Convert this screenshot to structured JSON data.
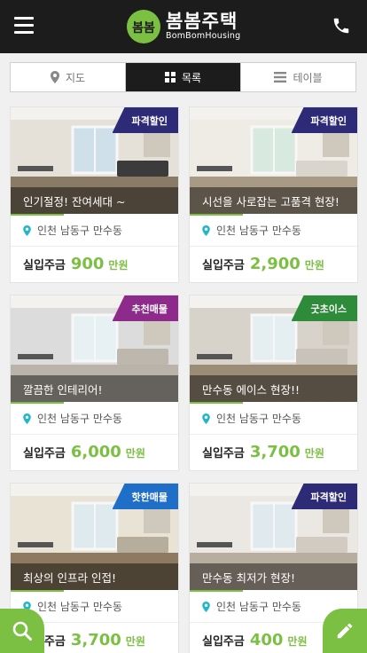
{
  "header": {
    "logo_mark": "봄봄",
    "title": "봄봄주택",
    "subtitle": "BomBomHousing"
  },
  "tabs": [
    {
      "label": "지도",
      "icon": "map-pin-icon",
      "active": false
    },
    {
      "label": "목록",
      "icon": "grid-icon",
      "active": true
    },
    {
      "label": "테이블",
      "icon": "list-icon",
      "active": false
    }
  ],
  "listings": [
    {
      "badge": "파격할인",
      "badge_color": "#2d2a78",
      "title": "인기절정! 잔여세대 ~",
      "location": "인천 남동구 만수동",
      "price_label": "실입주금",
      "price": "900",
      "unit": "만원"
    },
    {
      "badge": "파격할인",
      "badge_color": "#2d2a78",
      "title": "시선을 사로잡는 고품격 현장!",
      "location": "인천 남동구 만수동",
      "price_label": "실입주금",
      "price": "2,900",
      "unit": "만원"
    },
    {
      "badge": "추천매물",
      "badge_color": "#8e2a8b",
      "title": "깔끔한 인테리어!",
      "location": "인천 남동구 만수동",
      "price_label": "실입주금",
      "price": "6,000",
      "unit": "만원"
    },
    {
      "badge": "굿초이스",
      "badge_color": "#2e8b3a",
      "title": "만수동 에이스 현장!!",
      "location": "인천 남동구 만수동",
      "price_label": "실입주금",
      "price": "3,700",
      "unit": "만원"
    },
    {
      "badge": "핫한매물",
      "badge_color": "#1f6fc9",
      "title": "최상의 인프라 인접!",
      "location": "인천 남동구 만수동",
      "price_label": "실입주금",
      "price": "3,700",
      "unit": "만원"
    },
    {
      "badge": "파격할인",
      "badge_color": "#2d2a78",
      "title": "만수동 최저가 현장!",
      "location": "인천 남동구 만수동",
      "price_label": "실입주금",
      "price": "400",
      "unit": "만원"
    }
  ],
  "colors": {
    "accent": "#7bc043",
    "header_bg": "#1c1c1c"
  }
}
